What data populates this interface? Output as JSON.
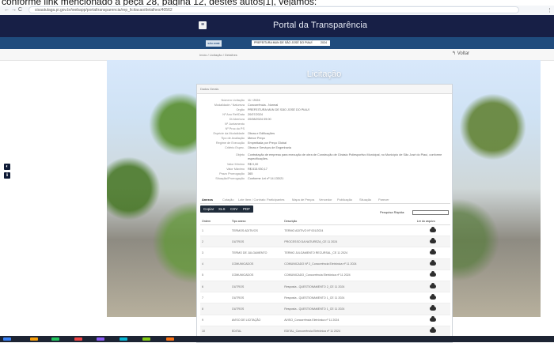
{
  "top_caption": "conforme link mencionado à peça 28, página 12, destes autos[1], vejamos:",
  "browser": {
    "nav": "←  →  C",
    "url": "sisautulaga.pi.gov.br/webapp/portaltransparencia/rep_licitacao/detalhes/40562",
    "menu_icon": "⋮"
  },
  "header": {
    "menu_icon": "≡",
    "title": "Portal da Transparência"
  },
  "filters": {
    "logo": "SÃO JOSÉ DO PIAUÍ",
    "entity": "PREFEITURA MUN DE SÃO JOSÉ DO PIAUÍ",
    "year": "2024"
  },
  "breadcrumb": "Início / Licitação / Detalhes",
  "back": "↰ Voltar",
  "page_title": "Licitação",
  "details_header": "Dados Gerais",
  "fields": [
    {
      "label": "Número Licitação",
      "value": "11 / 2024"
    },
    {
      "label": "Modalidade / Natureza",
      "value": "Concorrência - Normal"
    },
    {
      "label": "Orgão",
      "value": "PREFEITURA MUN DE SÃO JOSÉ DO PIAUÍ"
    },
    {
      "label": "Nº Ano Ref/Data",
      "value": "20/07/2024"
    },
    {
      "label": "Dt Abertura",
      "value": "20/08/2024 09:00"
    },
    {
      "label": "Nº Juntamento",
      "value": ""
    },
    {
      "label": "Nº Proc do PS",
      "value": ""
    },
    {
      "label": "Espécie da Modalidade",
      "value": "Obras e Edificações"
    },
    {
      "label": "Tipo de Avaliação",
      "value": "Menor Preço"
    },
    {
      "label": "Regime de Execução",
      "value": "Empreitada por Preço Global"
    },
    {
      "label": "Critério Espec.",
      "value": "Obras e Serviços de Engenharia"
    },
    {
      "label": "Objeto",
      "value": "Contratação de empresa para execução de obra de Construção de Ginásio Poliesportivo Municipal, no Município de São José do Piauí, conforme especificações."
    },
    {
      "label": "Valor Mínimo",
      "value": "R$ 0,00"
    },
    {
      "label": "Valor Máximo",
      "value": "R$ 815.930,17"
    },
    {
      "label": "Prazo Prorrogação",
      "value": "365"
    },
    {
      "label": "Situação/Prorrogação",
      "value": "Conforme Lei nº 14.133/21"
    }
  ],
  "tabs": [
    "Anexos",
    "Cotação",
    "Lote Item / Contrato",
    "Participantes",
    "Mapa de Preços",
    "Vencedor",
    "Publicação",
    "Situação",
    "Parecer"
  ],
  "actions": [
    "Copiar",
    "XLS",
    "CSV",
    "PDF"
  ],
  "search_label": "Pesquisa Rápida:",
  "table": {
    "headers": [
      "Ordem",
      "Tipo anexo",
      "Descrição",
      "Ler do arquivo"
    ],
    "rows": [
      {
        "ordem": "1",
        "tipo": "TERMOS ADITIVOS",
        "descricao": "TERMO ADITIVO Nº 001/2024"
      },
      {
        "ordem": "2",
        "tipo": "OUTROS",
        "descricao": "PROCESSO DA NATUREZA_CE 11 2024"
      },
      {
        "ordem": "3",
        "tipo": "TERMO DE JULGAMENTO",
        "descricao": "TERMO JULGAMENTO RECURSAL_CE 11 2024"
      },
      {
        "ordem": "4",
        "tipo": "COMUNICADOS",
        "descricao": "COMUNICADO Nº 2_Concorrência Eletrônica nº 11 2024"
      },
      {
        "ordem": "5",
        "tipo": "COMUNICADOS",
        "descricao": "COMUNICADO_Concorrência Eletrônica nº 11 2024"
      },
      {
        "ordem": "6",
        "tipo": "OUTROS",
        "descricao": "Resposta - QUESTIONAMENTO 2_CE 11 2024"
      },
      {
        "ordem": "7",
        "tipo": "OUTROS",
        "descricao": "Resposta - QUESTIONAMENTO 1_CE 11 2024"
      },
      {
        "ordem": "8",
        "tipo": "OUTROS",
        "descricao": "Resposta - QUESTIONAMENTO 1_CE 11 2024"
      },
      {
        "ordem": "9",
        "tipo": "AVISO DE LICITAÇÃO",
        "descricao": "AVISO_Concorrência Eletrônica nº 11 2024"
      },
      {
        "ordem": "10",
        "tipo": "EDITAL",
        "descricao": "EDITAL_Concorrência Eletrônica nº 11 2024"
      }
    ]
  },
  "colors": {
    "header": "#171f46",
    "strip": "#1f4b7d",
    "button": "#1f2b3a"
  }
}
